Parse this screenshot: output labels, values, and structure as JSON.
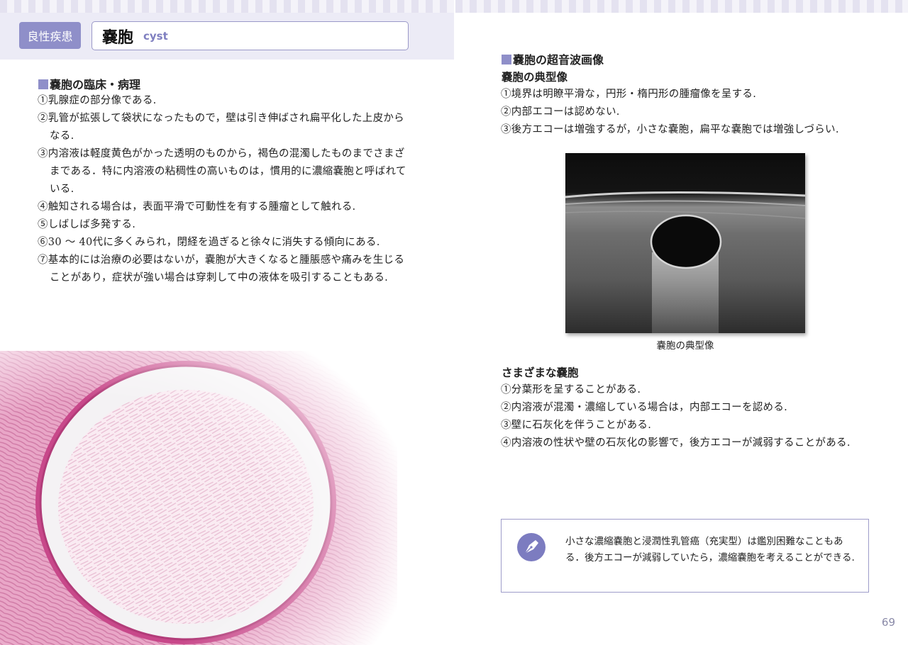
{
  "left_page": {
    "category_tag": "良性疾患",
    "title_jp": "嚢胞",
    "title_en": "cyst",
    "clinical": {
      "heading": "嚢胞の臨床・病理",
      "items": [
        "①乳腺症の部分像である.",
        "②乳管が拡張して袋状になったもので，壁は引き伸ばされ扁平化した上皮からなる.",
        "③内溶液は軽度黄色がかった透明のものから，褐色の混濁したものまでさまざまである．特に内溶液の粘稠性の高いものは，慣用的に濃縮嚢胞と呼ばれている.",
        "④触知される場合は，表面平滑で可動性を有する腫瘤として触れる.",
        "⑤しばしば多発する.",
        "⑥30 ～ 40代に多くみられ，閉経を過ぎると徐々に消失する傾向にある.",
        "⑦基本的には治療の必要はないが，嚢胞が大きくなると腫脹感や痛みを生じることがあり，症状が強い場合は穿刺して中の液体を吸引することもある."
      ]
    }
  },
  "right_page": {
    "us_heading": "嚢胞の超音波画像",
    "typical": {
      "heading": "嚢胞の典型像",
      "items": [
        "①境界は明瞭平滑な，円形・楕円形の腫瘤像を呈する.",
        "②内部エコーは認めない.",
        "③後方エコーは増強するが，小さな嚢胞，扁平な嚢胞では増強しづらい."
      ]
    },
    "image_caption": "嚢胞の典型像",
    "various": {
      "heading": "さまざまな嚢胞",
      "items": [
        "①分葉形を呈することがある.",
        "②内溶液が混濁・濃縮している場合は，内部エコーを認める.",
        "③壁に石灰化を伴うことがある.",
        "④内溶液の性状や壁の石灰化の影響で，後方エコーが減弱することがある."
      ]
    },
    "note": {
      "icon": "pen-nib-icon",
      "text": "小さな濃縮嚢胞と浸潤性乳管癌（充実型）は鑑別困難なこともある．後方エコーが減弱していたら，濃縮嚢胞を考えることができる."
    },
    "page_number": "69"
  },
  "colors": {
    "accent": "#8f8fc9",
    "header_band": "#ecebf6",
    "note_border": "#9e9cc9"
  }
}
